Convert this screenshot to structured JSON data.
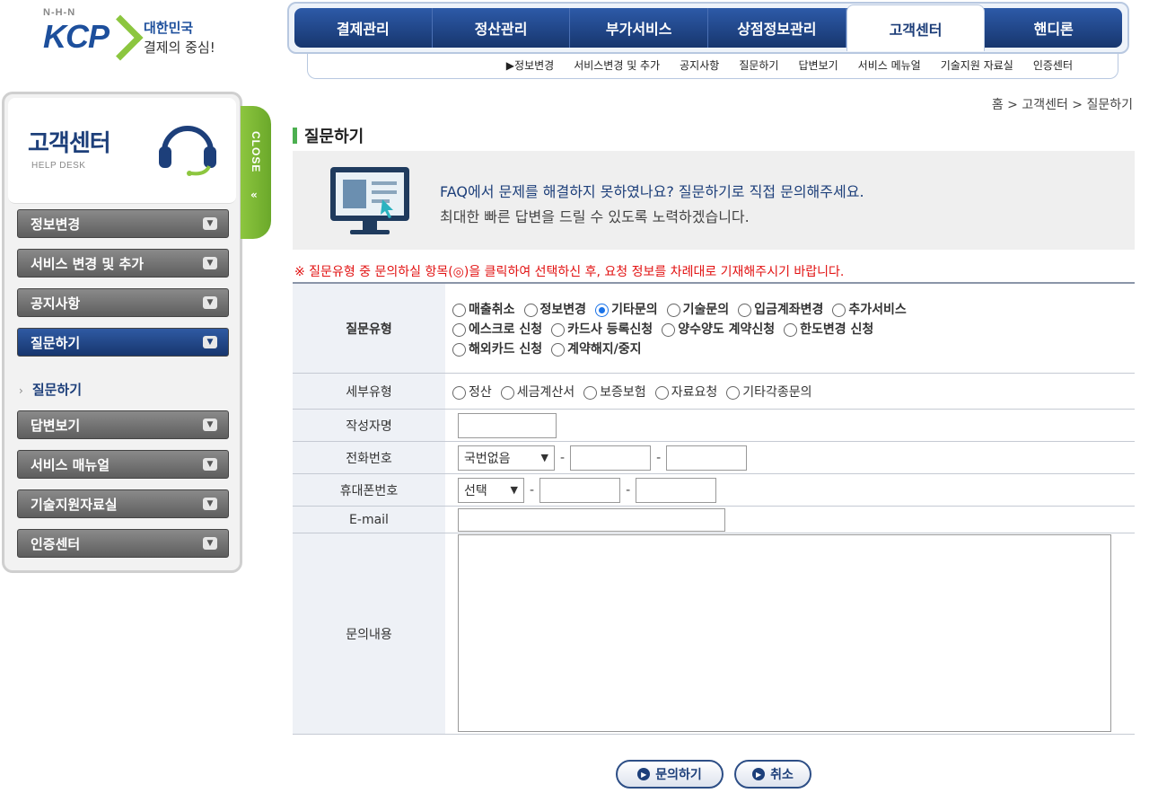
{
  "logo": {
    "nhn": "N-H-N",
    "kcp": "KCP",
    "tagline1": "대한민국",
    "tagline2": "결제의 중심!"
  },
  "topnav": {
    "tabs": [
      "결제관리",
      "정산관리",
      "부가서비스",
      "상점정보관리",
      "고객센터",
      "핸디론"
    ],
    "active": "고객센터",
    "subnav": [
      "▶정보변경",
      "서비스변경 및 추가",
      "공지사항",
      "질문하기",
      "답변보기",
      "서비스 메뉴얼",
      "기술지원 자료실",
      "인증센터"
    ]
  },
  "breadcrumb": "홈 > 고객센터 > 질문하기",
  "page_title": "질문하기",
  "sidebar": {
    "title": "고객센터",
    "subtitle": "HELP DESK",
    "close_label": "CLOSE",
    "items": [
      "정보변경",
      "서비스 변경 및 추가",
      "공지사항",
      "질문하기",
      "답변보기",
      "서비스 매뉴얼",
      "기술지원자료실",
      "인증센터"
    ],
    "active_item": "질문하기",
    "submenu": "질문하기"
  },
  "banner": {
    "line1": "FAQ에서 문제를 해결하지 못하였나요? 질문하기로 직접 문의해주세요.",
    "line2": "최대한 빠른 답변을 드릴 수 있도록 노력하겠습니다."
  },
  "notice": "※ 질문유형 중 문의하실 항목(◎)을 클릭하여 선택하신 후, 요청 정보를 차례대로 기재해주시기 바랍니다.",
  "form": {
    "question_type_label": "질문유형",
    "question_types": [
      "매출취소",
      "정보변경",
      "기타문의",
      "기술문의",
      "입금계좌변경",
      "추가서비스",
      "에스크로 신청",
      "카드사 등록신청",
      "양수양도 계약신청",
      "한도변경 신청",
      "해외카드 신청",
      "계약해지/중지"
    ],
    "question_type_selected": "기타문의",
    "detail_type_label": "세부유형",
    "detail_types": [
      "정산",
      "세금계산서",
      "보증보험",
      "자료요청",
      "기타각종문의"
    ],
    "author_label": "작성자명",
    "author_value": "",
    "phone_label": "전화번호",
    "phone_area": "국번없음",
    "mobile_label": "휴대폰번호",
    "mobile_carrier": "선택",
    "email_label": "E-mail",
    "email_value": "",
    "content_label": "문의내용",
    "content_value": ""
  },
  "buttons": {
    "submit": "문의하기",
    "cancel": "취소"
  },
  "colors": {
    "nav_blue": "#1d3f7a",
    "accent_green": "#8dc63f",
    "notice_red": "#e21212"
  }
}
